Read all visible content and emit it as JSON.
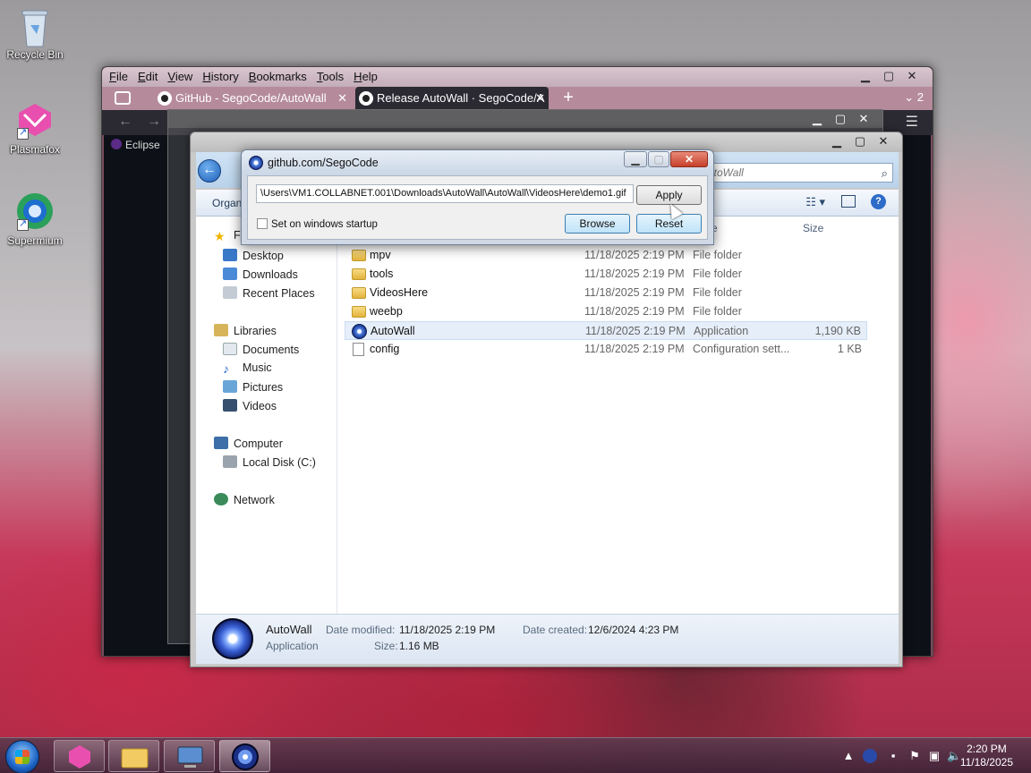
{
  "desktop": {
    "icons": [
      {
        "label": "Recycle Bin"
      },
      {
        "label": "Plasmafox"
      },
      {
        "label": "Supermium"
      }
    ]
  },
  "firefox": {
    "menu": [
      "File",
      "Edit",
      "View",
      "History",
      "Bookmarks",
      "Tools",
      "Help"
    ],
    "tabs": [
      {
        "label": "GitHub - SegoCode/AutoWall"
      },
      {
        "label": "Release AutoWall · SegoCode/A"
      }
    ],
    "tab_count": "2",
    "bookmark": "Eclipse"
  },
  "explorer": {
    "search_placeholder": "AutoWall",
    "organize": "Organ",
    "favorites": "Fa",
    "nav": {
      "favorites_items": [
        "Desktop",
        "Downloads",
        "Recent Places"
      ],
      "libraries": "Libraries",
      "library_items": [
        "Documents",
        "Music",
        "Pictures",
        "Videos"
      ],
      "computer": "Computer",
      "local_disk": "Local Disk (C:)",
      "network": "Network"
    },
    "columns": {
      "type": "e",
      "size": "Size"
    },
    "files": [
      {
        "name": "mpv",
        "date": "11/18/2025 2:19 PM",
        "type": "File folder",
        "size": "",
        "icon": "folder-icon"
      },
      {
        "name": "tools",
        "date": "11/18/2025 2:19 PM",
        "type": "File folder",
        "size": "",
        "icon": "folder-icon"
      },
      {
        "name": "VideosHere",
        "date": "11/18/2025 2:19 PM",
        "type": "File folder",
        "size": "",
        "icon": "folder-icon"
      },
      {
        "name": "weebp",
        "date": "11/18/2025 2:19 PM",
        "type": "File folder",
        "size": "",
        "icon": "folder-icon"
      },
      {
        "name": "AutoWall",
        "date": "11/18/2025 2:19 PM",
        "type": "Application",
        "size": "1,190 KB",
        "icon": "app-icon"
      },
      {
        "name": "config",
        "date": "11/18/2025 2:19 PM",
        "type": "Configuration sett...",
        "size": "1 KB",
        "icon": "config-file-icon"
      }
    ],
    "details": {
      "name": "AutoWall",
      "kind": "Application",
      "date_modified_label": "Date modified:",
      "date_modified": "11/18/2025 2:19 PM",
      "size_label": "Size:",
      "size": "1.16 MB",
      "date_created_label": "Date created:",
      "date_created": "12/6/2024 4:23 PM"
    }
  },
  "dialog": {
    "title": "github.com/SegoCode",
    "path_value": "\\Users\\VM1.COLLABNET.001\\Downloads\\AutoWall\\AutoWall\\VideosHere\\demo1.gif",
    "apply_label": "Apply",
    "startup_label": "Set on windows startup",
    "browse_label": "Browse",
    "reset_label": "Reset"
  },
  "taskbar": {
    "time": "2:20 PM",
    "date": "11/18/2025"
  }
}
